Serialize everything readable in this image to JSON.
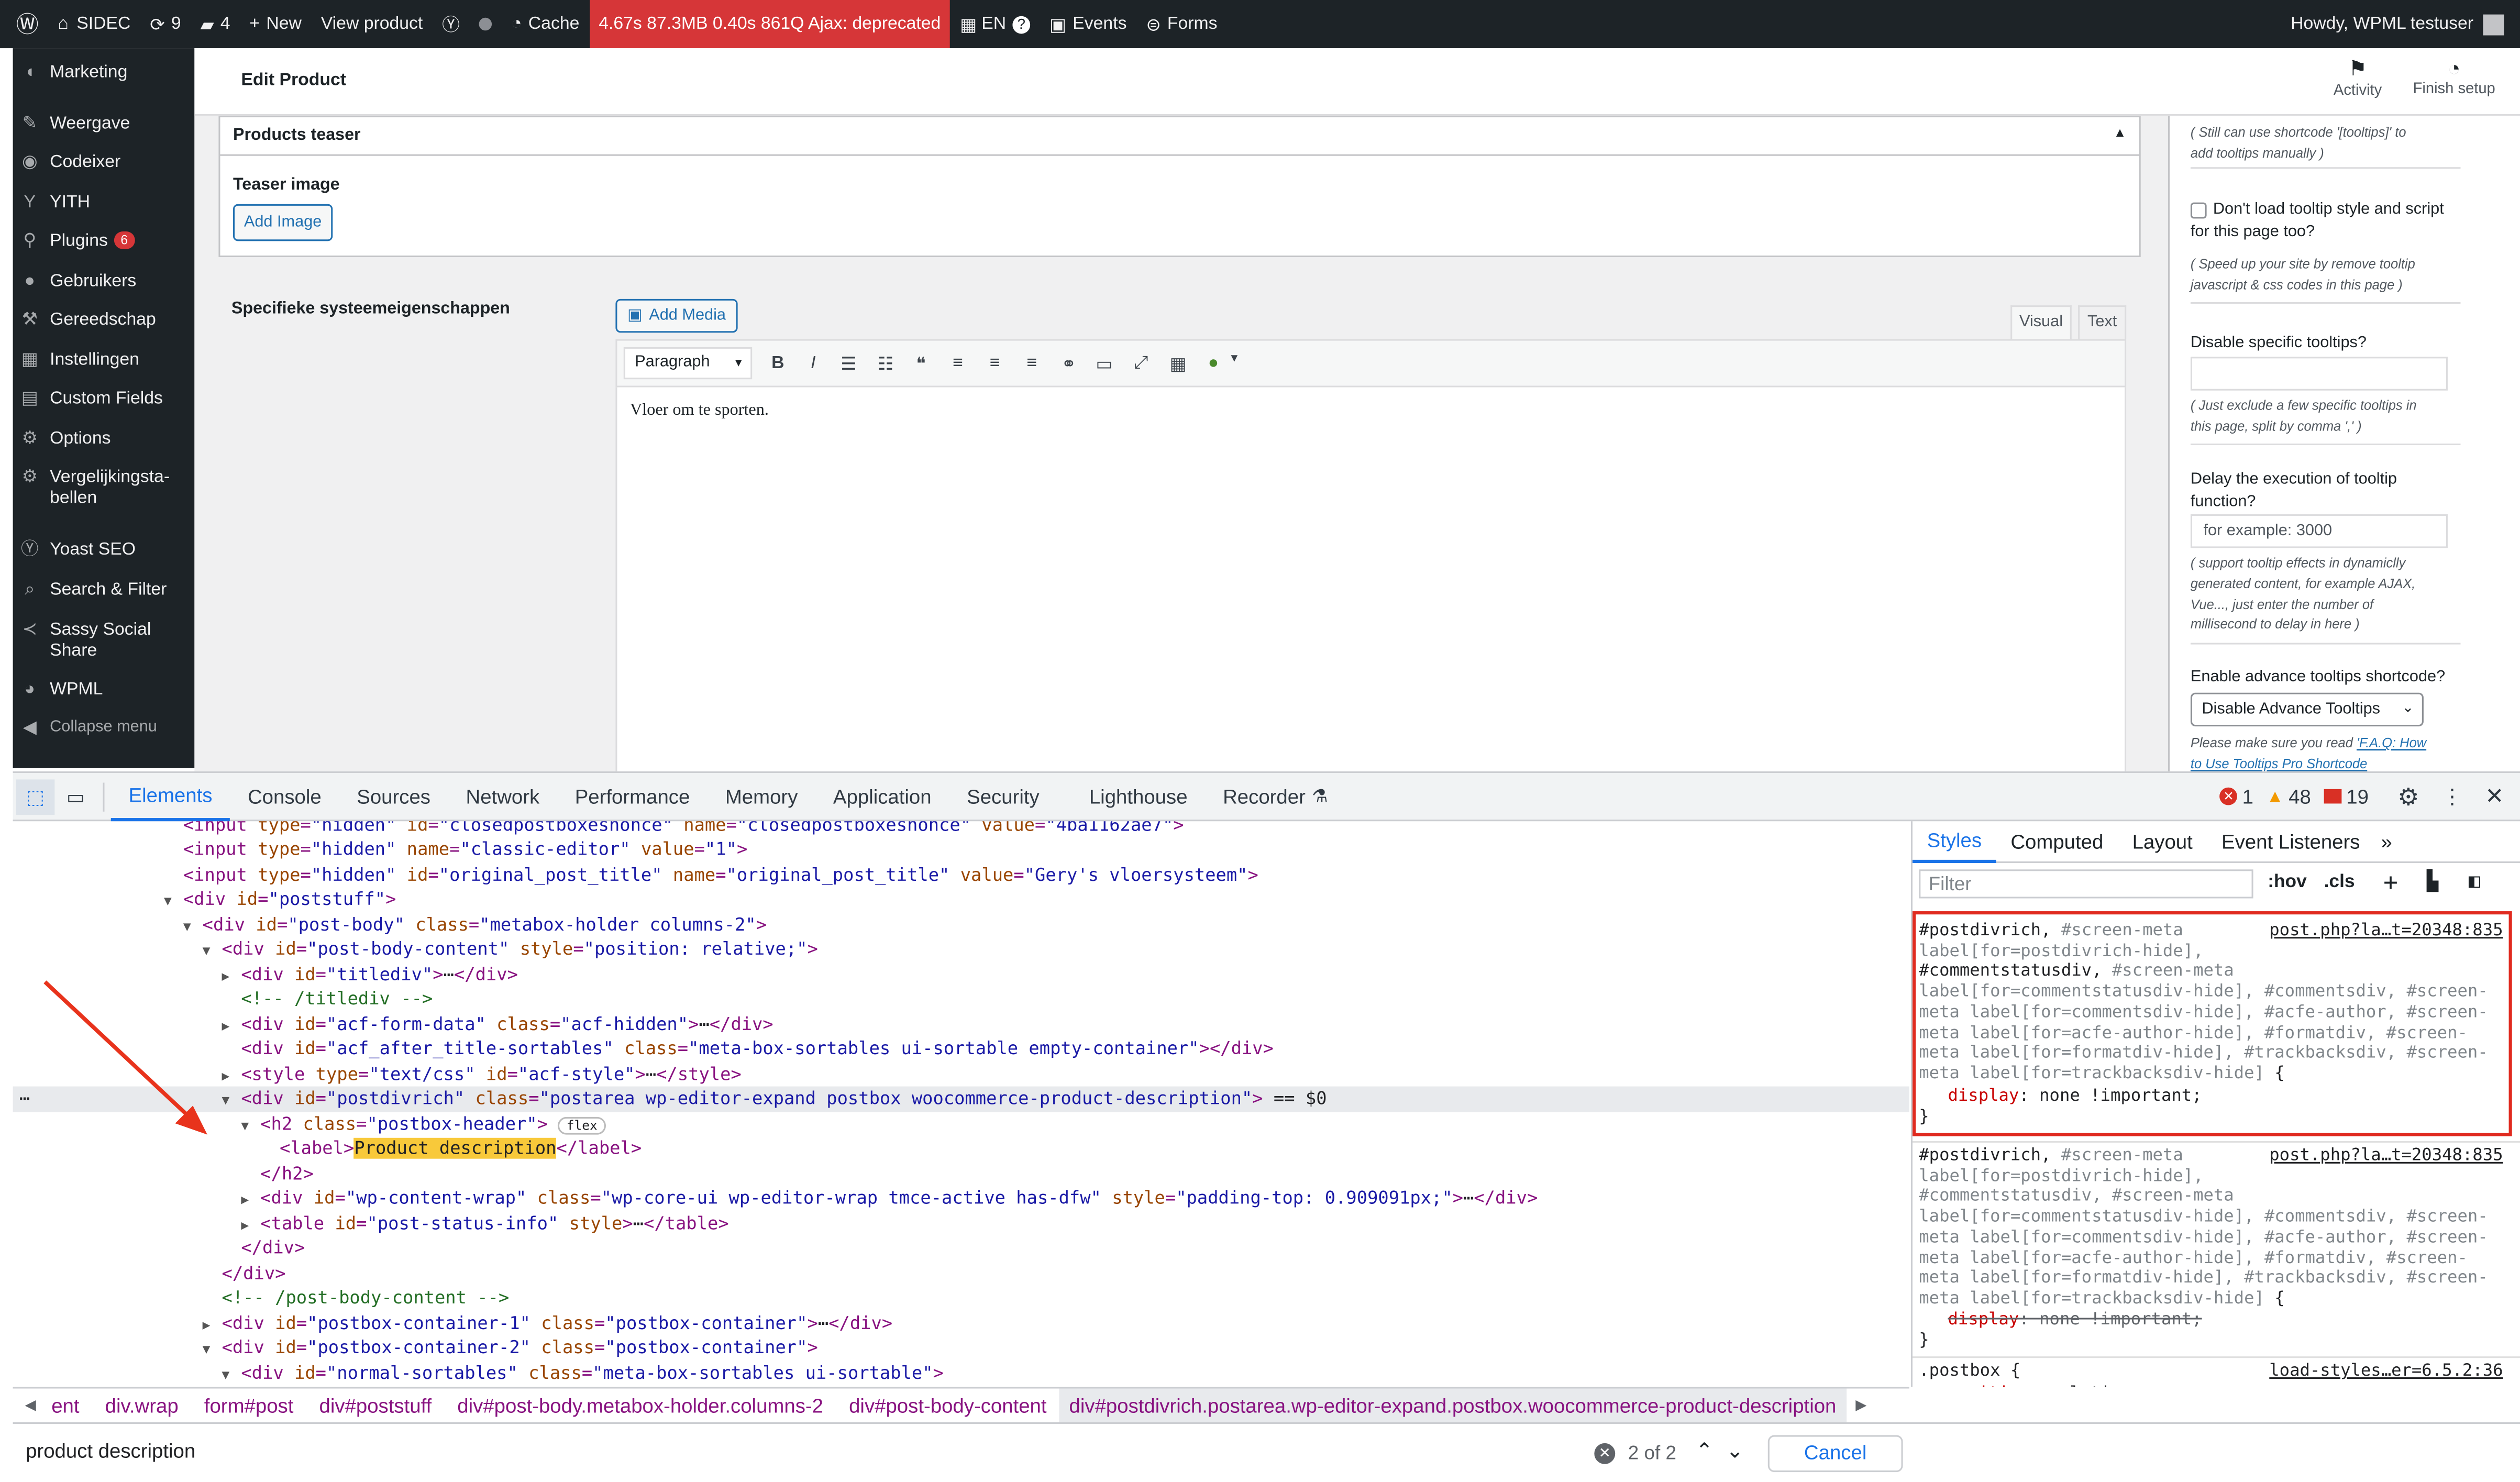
{
  "adminbar": {
    "site": "SIDEC",
    "updates": "9",
    "comments": "4",
    "new": "New",
    "view": "View product",
    "cache": "Cache",
    "perf": "4.67s 87.3MB 0.40s 861Q Ajax: deprecated",
    "lang": "EN",
    "events": "Events",
    "forms": "Forms",
    "howdy": "Howdy, WPML testuser"
  },
  "sidebar": {
    "items": [
      {
        "label": "Marketing"
      },
      {
        "label": "Weergave"
      },
      {
        "label": "Codeixer"
      },
      {
        "label": "YITH"
      },
      {
        "label": "Plugins",
        "badge": "6"
      },
      {
        "label": "Gebruikers"
      },
      {
        "label": "Gereedschap"
      },
      {
        "label": "Instellingen"
      },
      {
        "label": "Custom Fields"
      },
      {
        "label": "Options"
      },
      {
        "label": "Vergelijkingsta-"
      },
      {
        "label": "bellen"
      },
      {
        "label": "Yoast SEO"
      },
      {
        "label": "Search & Filter"
      },
      {
        "label": "Sassy Social"
      },
      {
        "label": "Share"
      },
      {
        "label": "WPML"
      },
      {
        "label": "Collapse menu"
      }
    ]
  },
  "header": {
    "title": "Edit Product",
    "activity": "Activity",
    "finish": "Finish setup"
  },
  "teaser": {
    "title": "Products teaser",
    "label": "Teaser image",
    "button": "Add Image"
  },
  "specs": {
    "label": "Specifieke systeemeigenschappen",
    "add_media": "Add Media",
    "tab_visual": "Visual",
    "tab_text": "Text",
    "format": "Paragraph",
    "content": "Vloer om te sporten."
  },
  "right": {
    "note1a": "( Still can use shortcode '[tooltips]' to",
    "note1b": "add tooltips manually )",
    "chk1a": "Don't load tooltip style and script",
    "chk1b": "for this page too?",
    "note2a": "( Speed up your site by remove tooltip",
    "note2b": "javascript & css codes in this page )",
    "disable_label": "Disable specific tooltips?",
    "note3a": "( Just exclude a few specific tooltips in",
    "note3b": "this page, split by comma ',' )",
    "delay_a": "Delay the execution of tooltip",
    "delay_b": "function?",
    "delay_placeholder": "for example: 3000",
    "note4a": "( support tooltip effects in dynamiclly",
    "note4b": "generated content, for example AJAX,",
    "note4c": "Vue..., just enter the number of",
    "note4d": "millisecond to delay in here )",
    "adv_label": "Enable advance tooltips shortcode?",
    "adv_select": "Disable Advance Tooltips",
    "note5a": "Please make sure you read ",
    "note5b": "'F.A.Q: How",
    "note5c": "to Use Tooltips Pro Shortcode"
  },
  "devtools": {
    "tabs": [
      "Elements",
      "Console",
      "Sources",
      "Network",
      "Performance",
      "Memory",
      "Application",
      "Security",
      "Lighthouse",
      "Recorder"
    ],
    "errors": "1",
    "warnings": "48",
    "issues": "19",
    "side_tabs": [
      "Styles",
      "Computed",
      "Layout",
      "Event Listeners"
    ],
    "filter_placeholder": "Filter",
    "hov": ":hov",
    ".cls": ".cls",
    "cls": ".cls",
    "link1": "post.php?la…t=20348:835",
    "link2": "post.php?la…t=20348:835",
    "link3": "load-styles…er=6.5.2:36",
    "crumbs": [
      "ent",
      "div.wrap",
      "form#post",
      "div#poststuff",
      "div#post-body.metabox-holder.columns-2",
      "div#post-body-content",
      "div#postdivrich.postarea.wp-editor-expand.postbox.woocommerce-product-description"
    ],
    "search_value": "product description",
    "search_count": "2 of 2",
    "cancel": "Cancel"
  }
}
